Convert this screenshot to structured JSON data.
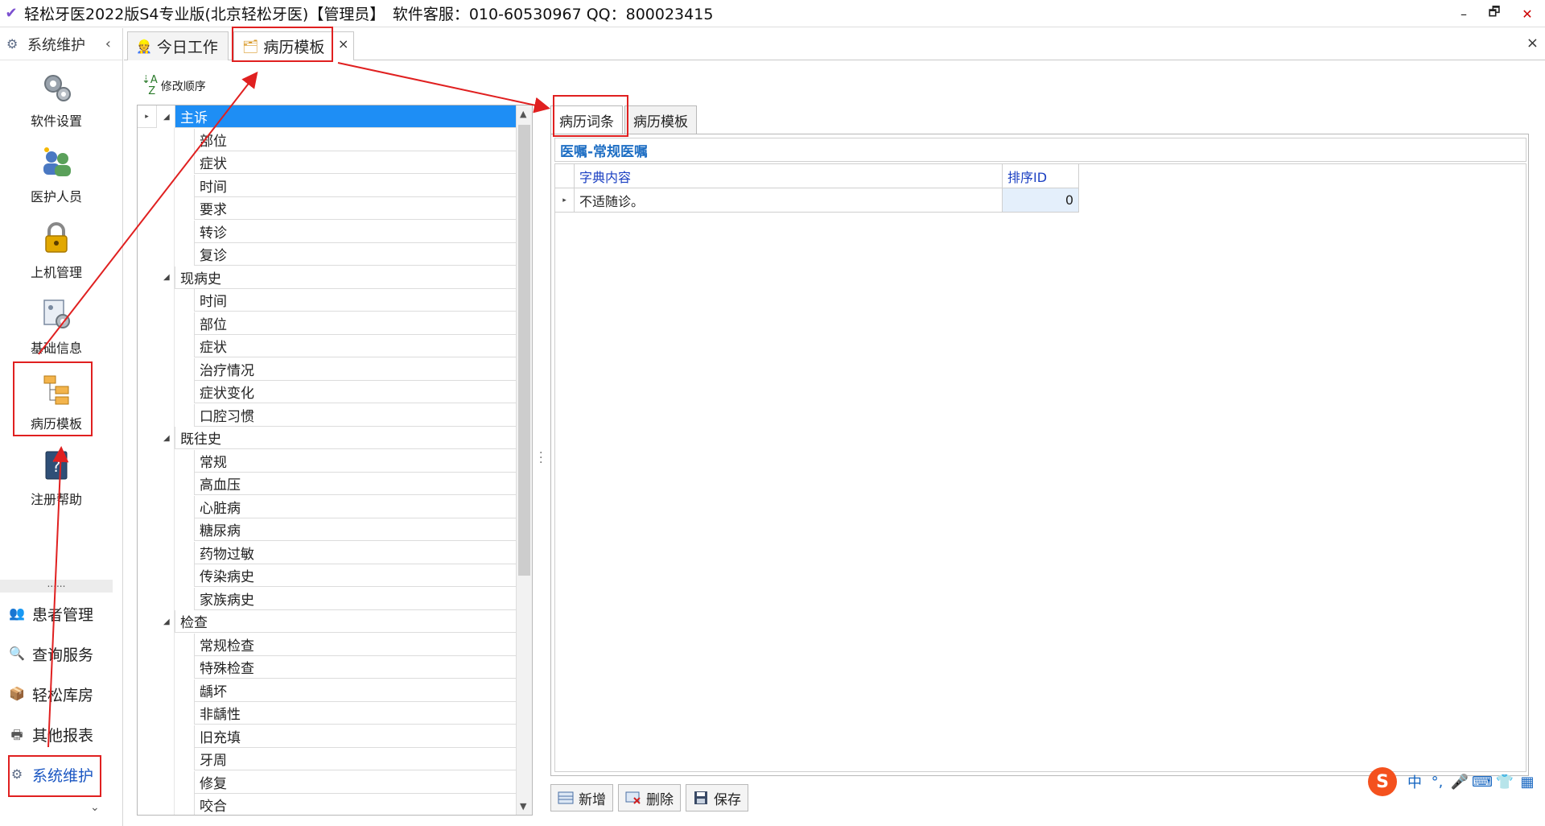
{
  "window": {
    "title": "轻松牙医2022版S4专业版(北京轻松牙医)【管理员】　软件客服：010-60530967 QQ：800023415",
    "controls": {
      "minimize": "–",
      "restore": "🗗",
      "close": "✕"
    }
  },
  "sidebar": {
    "header": "系统维护",
    "collapse_glyph": "‹",
    "big_items": [
      {
        "label": "软件设置",
        "icon": "gear-icon"
      },
      {
        "label": "医护人员",
        "icon": "staff-icon"
      },
      {
        "label": "上机管理",
        "icon": "lock-icon"
      },
      {
        "label": "基础信息",
        "icon": "settings-doc-icon"
      },
      {
        "label": "病历模板",
        "icon": "template-tree-icon"
      },
      {
        "label": "注册帮助",
        "icon": "help-book-icon"
      }
    ],
    "splitter": "......",
    "small_items": [
      {
        "label": "患者管理",
        "icon": "patients-icon"
      },
      {
        "label": "查询服务",
        "icon": "search-icon"
      },
      {
        "label": "轻松库房",
        "icon": "box-icon"
      },
      {
        "label": "其他报表",
        "icon": "report-icon"
      },
      {
        "label": "系统维护",
        "icon": "gear-icon"
      }
    ],
    "bottom_chevron": "⌄"
  },
  "tabs": {
    "items": [
      {
        "label": "今日工作",
        "icon": "worker-icon"
      },
      {
        "label": "病历模板",
        "icon": "template-tree-icon"
      }
    ],
    "tab_close": "×",
    "bar_close": "×"
  },
  "toolbar": {
    "sort_label": "修改顺序"
  },
  "tree": {
    "groups": [
      {
        "label": "主诉",
        "children": [
          "部位",
          "症状",
          "时间",
          "要求",
          "转诊",
          "复诊"
        ]
      },
      {
        "label": "现病史",
        "children": [
          "时间",
          "部位",
          "症状",
          "治疗情况",
          "症状变化",
          "口腔习惯"
        ]
      },
      {
        "label": "既往史",
        "children": [
          "常规",
          "高血压",
          "心脏病",
          "糖尿病",
          "药物过敏",
          "传染病史",
          "家族病史"
        ]
      },
      {
        "label": "检查",
        "children": [
          "常规检查",
          "特殊检查",
          "龋坏",
          "非龋性",
          "旧充填",
          "牙周",
          "修复",
          "咬合"
        ]
      }
    ]
  },
  "right_panel": {
    "tabs": [
      "病历词条",
      "病历模板"
    ],
    "group_title": "医嘱-常规医嘱",
    "columns": [
      "字典内容",
      "排序ID"
    ],
    "rows": [
      {
        "content": "不适随诊。",
        "sort_id": "0"
      }
    ]
  },
  "buttons": {
    "add": "新增",
    "delete": "删除",
    "save": "保存"
  },
  "ime": {
    "logo": "S",
    "mode": "中",
    "punct": "°,",
    "mic": "🎤",
    "keyboard": "⌨",
    "skin": "👕",
    "menu": "▦"
  },
  "colors": {
    "selected": "#1e8ef5",
    "annotation": "#e02020",
    "header_text": "#1a3fc2",
    "group_title": "#1f6fc4"
  }
}
